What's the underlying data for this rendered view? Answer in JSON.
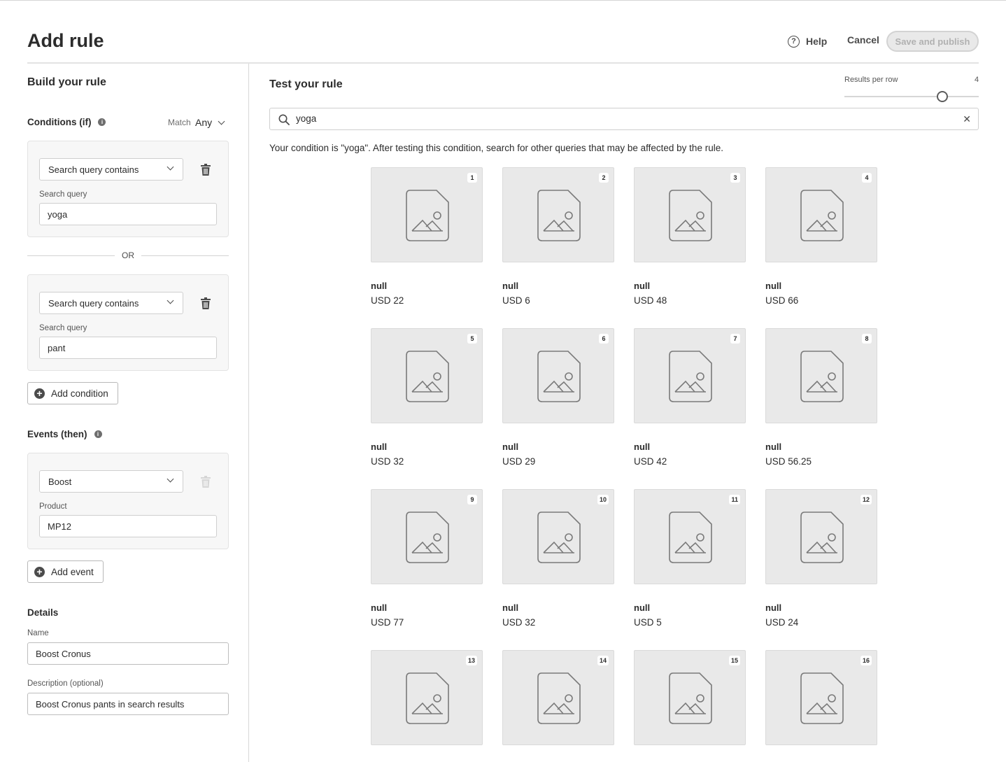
{
  "header": {
    "title": "Add rule",
    "help_label": "Help",
    "cancel_label": "Cancel",
    "publish_label": "Save and publish"
  },
  "build": {
    "title": "Build your rule",
    "conditions_title": "Conditions (if)",
    "match_label": "Match",
    "match_value": "Any",
    "conditions": [
      {
        "type": "Search query contains",
        "field_label": "Search query",
        "value": "yoga"
      },
      {
        "type": "Search query contains",
        "field_label": "Search query",
        "value": "pant"
      }
    ],
    "or_label": "OR",
    "add_condition_label": "Add condition",
    "events_title": "Events (then)",
    "event": {
      "type": "Boost",
      "field_label": "Product",
      "value": "MP12"
    },
    "add_event_label": "Add event",
    "details_title": "Details",
    "name_label": "Name",
    "name_value": "Boost Cronus",
    "description_label": "Description (optional)",
    "description_value": "Boost Cronus pants in search results"
  },
  "test": {
    "title": "Test your rule",
    "results_per_row_label": "Results per row",
    "results_per_row_value": "4",
    "search_value": "yoga",
    "hint": "Your condition is \"yoga\". After testing this condition, search for other queries that may be affected by the rule.",
    "products": [
      {
        "rank": "1",
        "name": "null",
        "price": "USD 22"
      },
      {
        "rank": "2",
        "name": "null",
        "price": "USD 6"
      },
      {
        "rank": "3",
        "name": "null",
        "price": "USD 48"
      },
      {
        "rank": "4",
        "name": "null",
        "price": "USD 66"
      },
      {
        "rank": "5",
        "name": "null",
        "price": "USD 32"
      },
      {
        "rank": "6",
        "name": "null",
        "price": "USD 29"
      },
      {
        "rank": "7",
        "name": "null",
        "price": "USD 42"
      },
      {
        "rank": "8",
        "name": "null",
        "price": "USD 56.25"
      },
      {
        "rank": "9",
        "name": "null",
        "price": "USD 77"
      },
      {
        "rank": "10",
        "name": "null",
        "price": "USD 32"
      },
      {
        "rank": "11",
        "name": "null",
        "price": "USD 5"
      },
      {
        "rank": "12",
        "name": "null",
        "price": "USD 24"
      },
      {
        "rank": "13",
        "name": "",
        "price": ""
      },
      {
        "rank": "14",
        "name": "",
        "price": ""
      },
      {
        "rank": "15",
        "name": "",
        "price": ""
      },
      {
        "rank": "16",
        "name": "",
        "price": ""
      }
    ]
  },
  "icons": {
    "help": "help-circle-icon",
    "info": "info-icon",
    "trash": "trash-icon",
    "add": "add-circle-icon",
    "search": "search-icon",
    "clear": "close-icon",
    "image_placeholder": "image-placeholder-icon"
  },
  "colors": {
    "text": "#2c2c2c",
    "card_bg": "#f7f7f7",
    "tile_bg": "#e9e9e9",
    "disabled": "#b1b1b1"
  }
}
